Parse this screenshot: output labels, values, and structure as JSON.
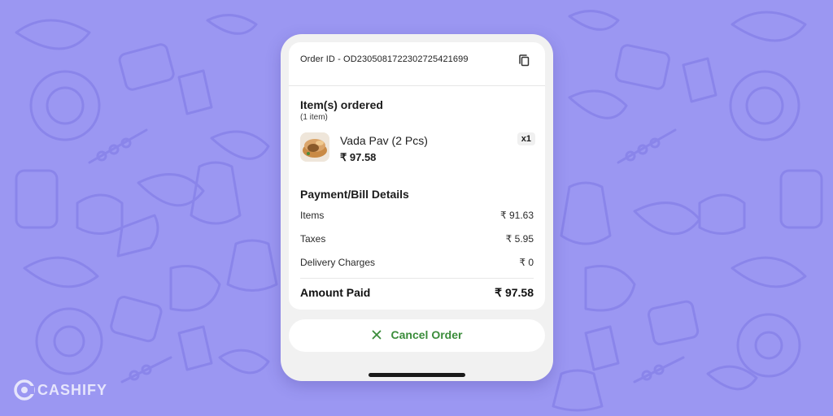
{
  "order": {
    "id_text": "Order ID - OD230508172230272542169 9",
    "id_display": "Order ID - OD2305081722302725421699"
  },
  "items_section": {
    "title": "Item(s) ordered",
    "count": "(1 item)",
    "items": [
      {
        "name": "Vada Pav (2 Pcs)",
        "price": "₹ 97.58",
        "quantity": "x1",
        "icon": "vada-pav-thumbnail"
      }
    ]
  },
  "bill": {
    "title": "Payment/Bill Details",
    "rows": [
      {
        "label": "Items",
        "value": "₹ 91.63"
      },
      {
        "label": "Taxes",
        "value": "₹ 5.95"
      },
      {
        "label": "Delivery Charges",
        "value": "₹ 0"
      }
    ],
    "total": {
      "label": "Amount Paid",
      "value": "₹ 97.58"
    }
  },
  "actions": {
    "cancel_label": "Cancel Order"
  },
  "brand": {
    "name": "CASHIFY"
  },
  "colors": {
    "background": "#9b97f2",
    "pattern_line": "#8a85ea",
    "accent_green": "#3a8c3a",
    "card": "#ffffff",
    "phone_bg": "#f1f1f1"
  },
  "icons": {
    "copy": "copy-icon",
    "cancel": "close-icon"
  }
}
